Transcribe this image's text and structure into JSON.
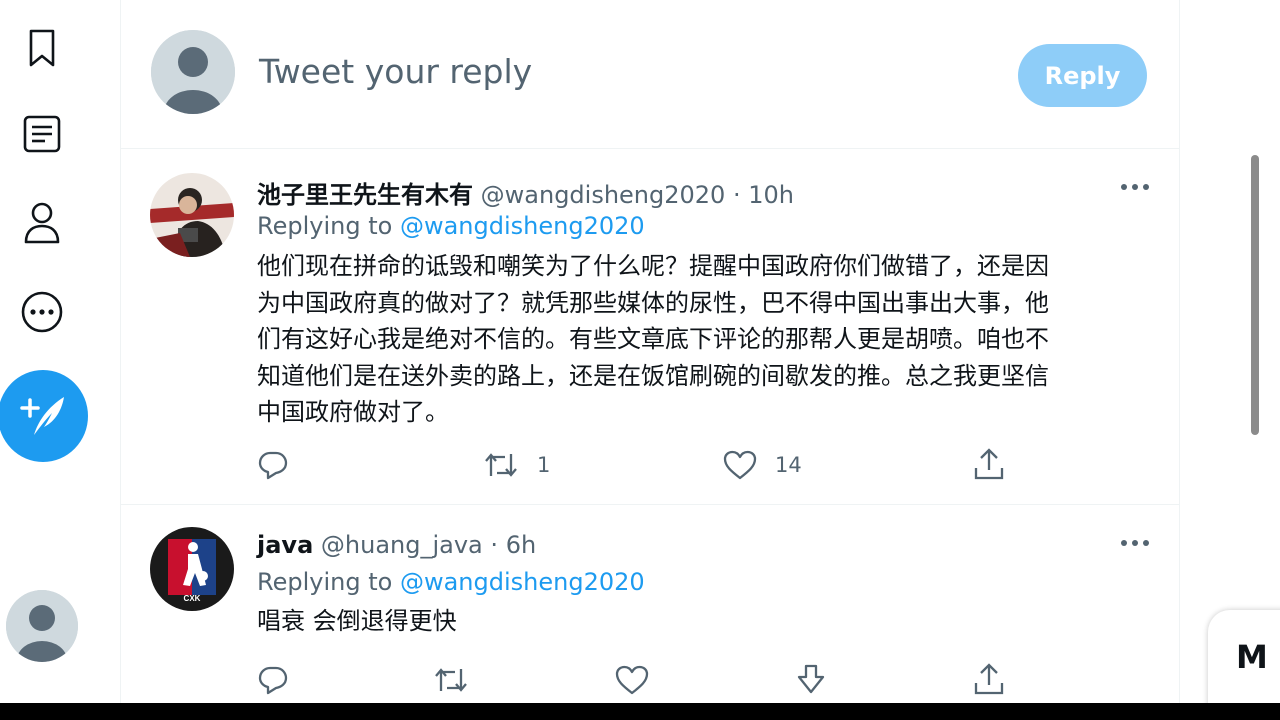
{
  "reply_box": {
    "placeholder": "Tweet your reply",
    "button_label": "Reply"
  },
  "tweets": [
    {
      "name": "池子里王先生有木有",
      "handle": "@wangdisheng2020",
      "time": "10h",
      "replying_prefix": "Replying to",
      "replying_to": "@wangdisheng2020",
      "text_lines": [
        "他们现在拼命的诋毁和嘲笑为了什么呢？提醒中国政府你们做错了，还是因",
        "为中国政府真的做对了？就凭那些媒体的尿性，巴不得中国出事出大事，他",
        "们有这好心我是绝对不信的。有些文章底下评论的那帮人更是胡喷。咱也不",
        "知道他们是在送外卖的路上，还是在饭馆刷碗的间歇发的推。总之我更坚信",
        "中国政府做对了。"
      ],
      "retweets": "1",
      "likes": "14"
    },
    {
      "name": "java",
      "handle": "@huang_java",
      "time": "6h",
      "replying_prefix": "Replying to",
      "replying_to": "@wangdisheng2020",
      "text_lines": [
        "唱衰 会倒退得更快"
      ],
      "avatar_text": "CXK"
    }
  ],
  "side_panel": {
    "label": "M"
  },
  "colors": {
    "accent": "#1d9bf0",
    "reply_button_disabled": "#8ecdf8",
    "secondary_text": "#536471",
    "border": "#eff3f4"
  },
  "icons": {
    "nav": [
      "bookmark-icon",
      "lists-icon",
      "profile-icon",
      "more-circle-icon"
    ],
    "compose": "compose-tweet-icon",
    "actions": [
      "reply-icon",
      "retweet-icon",
      "like-icon",
      "share-icon"
    ]
  }
}
